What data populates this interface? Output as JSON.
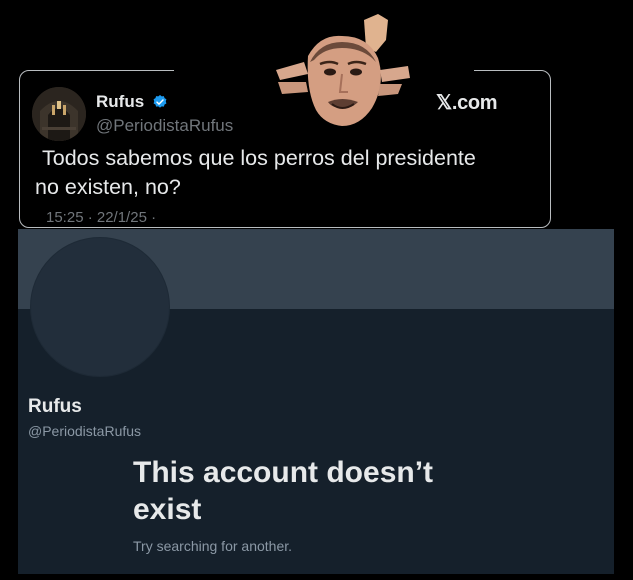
{
  "tweet": {
    "display_name": "Rufus",
    "handle": "@PeriodistaRufus",
    "brand": "𝕏.com",
    "text_line1": "Todos sabemos que los perros del presidente",
    "text_line2": "no existen, no?",
    "meta": "15:25 · 22/1/25 ·",
    "verified_icon": "verified-badge-icon",
    "accent_color": "#1d9bf0"
  },
  "profile": {
    "display_name": "Rufus",
    "handle": "@PeriodistaRufus",
    "empty_title_line1": "This account doesn’t",
    "empty_title_line2": "exist",
    "empty_subtitle": "Try searching for another.",
    "background_color": "#15202b",
    "banner_color": "#35424f"
  }
}
